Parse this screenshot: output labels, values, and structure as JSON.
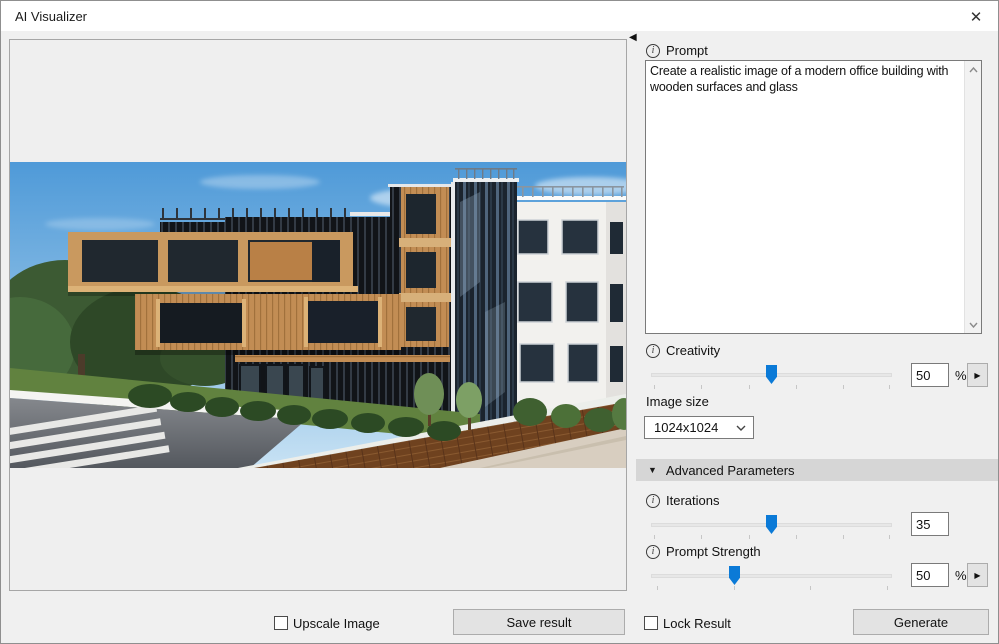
{
  "window": {
    "title": "AI Visualizer",
    "close_icon": "✕"
  },
  "preview": {
    "description": "Photorealistic render of a modern office building with black slat cladding, wooden volumes and glass beside a white building under a blue sky",
    "upscale_checkbox_label": "Upscale Image",
    "upscale_checked": false,
    "save_button_label": "Save result"
  },
  "controls": {
    "prompt": {
      "label": "Prompt",
      "value": "Create a realistic image of a modern office building with wooden surfaces and glass"
    },
    "creativity": {
      "label": "Creativity",
      "value": "50",
      "unit": "%",
      "slider_percent": 50
    },
    "image_size": {
      "label": "Image size",
      "selected": "1024x1024"
    },
    "advanced_header": "Advanced Parameters",
    "iterations": {
      "label": "Iterations",
      "value": "35",
      "slider_percent": 50
    },
    "prompt_strength": {
      "label": "Prompt Strength",
      "value": "50",
      "unit": "%",
      "slider_percent": 34
    },
    "lock_checkbox_label": "Lock Result",
    "lock_checked": false,
    "generate_button_label": "Generate"
  },
  "colors": {
    "accent": "#0b7ad7",
    "advanced_header_bg": "#d6d6d6",
    "content_bg": "#f0f0f0"
  }
}
